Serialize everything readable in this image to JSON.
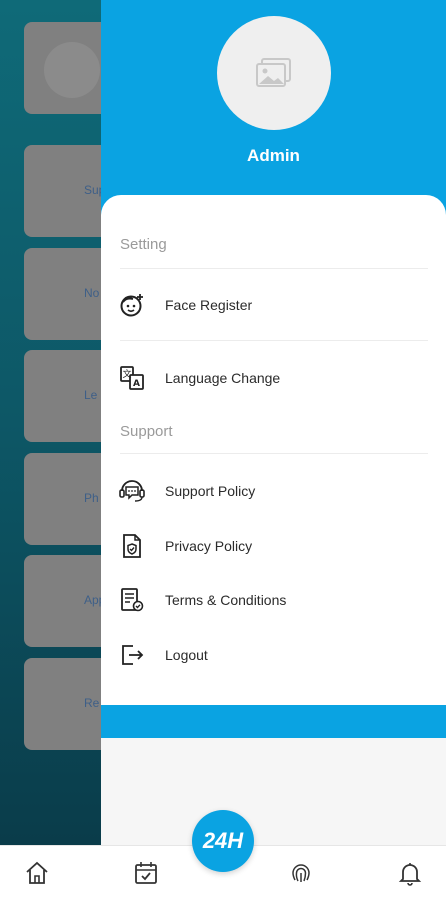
{
  "background": {
    "cards": [
      "",
      "Sup",
      "No",
      "Le",
      "Ph",
      "App",
      "Re"
    ]
  },
  "drawer": {
    "profile_name": "Admin",
    "sections": {
      "setting": "Setting",
      "support": "Support"
    },
    "items": {
      "face_register": "Face Register",
      "language_change": "Language Change",
      "support_policy": "Support Policy",
      "privacy_policy": "Privacy Policy",
      "terms": "Terms & Conditions",
      "logout": "Logout"
    }
  },
  "bottom_nav": {
    "fab_label": "24H",
    "items": [
      "home-icon",
      "calendar-check-icon",
      "fingerprint-icon",
      "bell-icon"
    ]
  },
  "colors": {
    "accent": "#0aa3e2",
    "background_teal": "#0d5a6a"
  }
}
